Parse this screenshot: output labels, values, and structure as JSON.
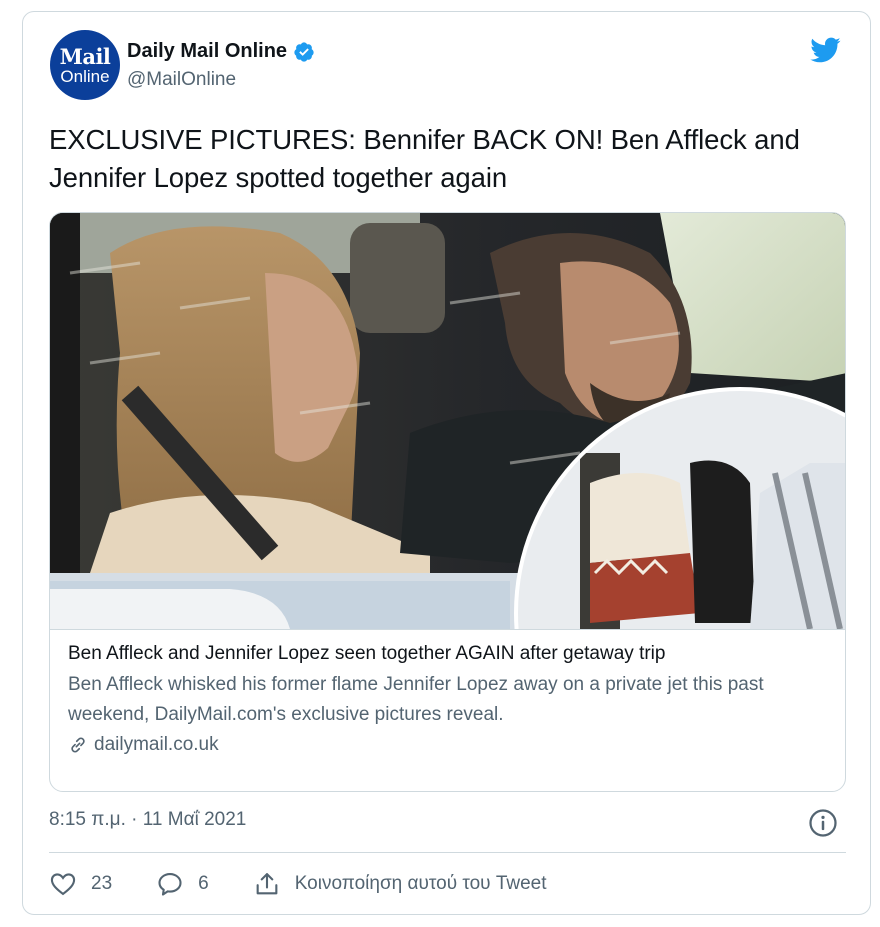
{
  "author": {
    "avatar_line1": "Mail",
    "avatar_line2": "Online",
    "name": "Daily Mail Online",
    "handle": "@MailOnline"
  },
  "icons": {
    "verified": "verified-badge-icon",
    "brand": "twitter-bird-icon",
    "link": "link-icon",
    "info": "info-icon",
    "like": "heart-icon",
    "reply": "reply-bubble-icon",
    "share": "share-icon"
  },
  "tweet": {
    "text": "EXCLUSIVE PICTURES: Bennifer BACK ON! Ben Affleck and Jennifer Lopez spotted together again"
  },
  "card": {
    "title": "Ben Affleck and Jennifer Lopez seen together AGAIN after getaway trip",
    "description": "Ben Affleck whisked his former flame Jennifer Lopez away on a private jet this past weekend, DailyMail.com's exclusive pictures reveal.",
    "domain": "dailymail.co.uk"
  },
  "meta": {
    "timestamp": "8:15 π.μ. · 11 Μαΐ 2021"
  },
  "actions": {
    "likes": "23",
    "replies": "6",
    "share_label": "Κοινοποίηση αυτού του Tweet"
  },
  "colors": {
    "brand_blue": "#1d9bf0",
    "avatar_blue": "#0b3f9a",
    "text_primary": "#0f1419",
    "text_secondary": "#536471",
    "border": "#cfd9de"
  }
}
